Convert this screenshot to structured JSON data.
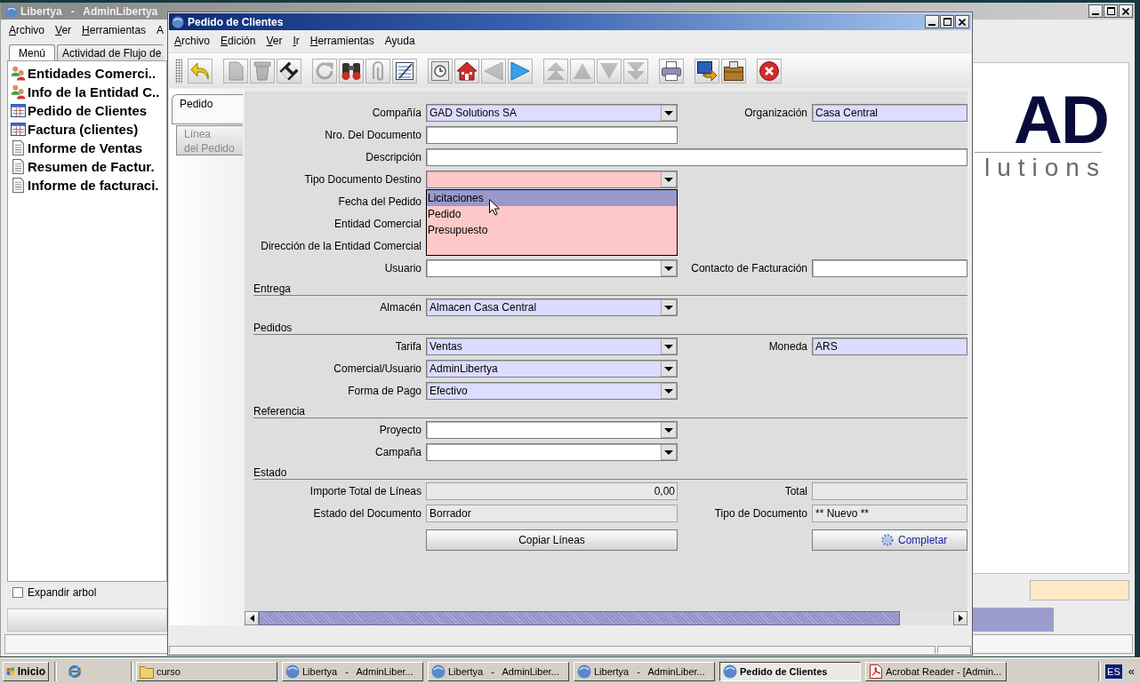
{
  "main_window": {
    "title": "Libertya   -   AdminLibertya",
    "menu": [
      {
        "label": "Archivo",
        "mnemonic": true
      },
      {
        "label": "Ver",
        "mnemonic": true
      },
      {
        "label": "Herramientas",
        "mnemonic": true
      },
      {
        "label": "A",
        "mnemonic": false
      }
    ],
    "tabs": [
      {
        "label": "Menú",
        "selected": true
      },
      {
        "label": "Actividad de Flujo de",
        "selected": false
      }
    ],
    "menu_tree": [
      {
        "label": "Entidades Comerci..",
        "kind": "entity"
      },
      {
        "label": "Info de la Entidad C..",
        "kind": "entity"
      },
      {
        "label": "Pedido de Clientes",
        "kind": "window"
      },
      {
        "label": "Factura (clientes)",
        "kind": "window"
      },
      {
        "label": "Informe de Ventas",
        "kind": "report"
      },
      {
        "label": "Resumen de Factur.",
        "kind": "report"
      },
      {
        "label": "Informe de facturaci.",
        "kind": "report"
      }
    ],
    "expand_tree": {
      "label": "Expandir arbol",
      "checked": false
    },
    "logo": {
      "mark": "AD",
      "tagline": "lutions"
    }
  },
  "order_window": {
    "title": "Pedido de Clientes",
    "menu": [
      {
        "label": "Archivo",
        "mnemonic": true
      },
      {
        "label": "Edición",
        "mnemonic": true
      },
      {
        "label": "Ver",
        "mnemonic": true
      },
      {
        "label": "Ir",
        "mnemonic": true
      },
      {
        "label": "Herramientas",
        "mnemonic": true
      },
      {
        "label": "Ayuda",
        "mnemonic": false
      }
    ],
    "toolbar": [
      {
        "buttons": [
          {
            "disabled": false
          }
        ]
      },
      {
        "buttons": [
          {
            "disabled": true
          },
          {
            "disabled": true
          },
          {
            "disabled": false
          }
        ]
      },
      {
        "buttons": [
          {
            "disabled": true
          },
          {
            "disabled": false
          },
          {
            "disabled": true
          },
          {
            "disabled": false
          }
        ]
      },
      {
        "buttons": [
          {
            "disabled": false
          },
          {
            "disabled": false
          },
          {
            "disabled": true
          },
          {
            "disabled": false
          }
        ]
      },
      {
        "buttons": [
          {
            "disabled": true
          },
          {
            "disabled": true
          },
          {
            "disabled": true
          },
          {
            "disabled": true
          }
        ]
      },
      {
        "buttons": [
          {
            "disabled": false
          }
        ]
      },
      {
        "buttons": [
          {
            "disabled": false
          },
          {
            "disabled": false
          }
        ]
      },
      {
        "buttons": [
          {
            "disabled": false
          }
        ]
      }
    ],
    "tabs": [
      {
        "label": "Pedido",
        "selected": true
      },
      {
        "label": "Línea\ndel Pedido",
        "selected": false
      }
    ],
    "form": [
      {
        "kind": "row",
        "fields": [
          {
            "label": "Compañía",
            "kind": "combo",
            "mandatory": true,
            "read_only": false,
            "value": "GAD Solutions SA"
          },
          {
            "label": "Organización",
            "kind": "text",
            "mandatory": true,
            "read_only": false,
            "value": "Casa Central"
          }
        ]
      },
      {
        "kind": "row",
        "fields": [
          {
            "label": "Nro. Del Documento",
            "kind": "text",
            "mandatory": false,
            "read_only": false
          }
        ]
      },
      {
        "kind": "row",
        "fields": [
          {
            "label": "Descripción",
            "kind": "long_text",
            "mandatory": false,
            "read_only": false
          }
        ]
      },
      {
        "kind": "row",
        "fields": [
          {
            "label": "Tipo Documento Destino",
            "kind": "combo",
            "mandatory": true,
            "read_only": false,
            "open": true,
            "options": [
              {
                "label": "Licitaciones",
                "selected": true
              },
              {
                "label": "Pedido",
                "selected": false
              },
              {
                "label": "Presupuesto",
                "selected": false
              }
            ]
          }
        ]
      },
      {
        "kind": "row",
        "fields": [
          {
            "label": "Fecha del Pedido"
          }
        ]
      },
      {
        "kind": "row",
        "fields": [
          {
            "label": "Entidad Comercial"
          }
        ]
      },
      {
        "kind": "row",
        "fields": [
          {
            "label": "Dirección de la Entidad Comercial"
          }
        ]
      },
      {
        "kind": "row",
        "fields": [
          {
            "label": "Usuario",
            "kind": "combo",
            "mandatory": false,
            "read_only": false
          },
          {
            "label": "Contacto de Facturación",
            "kind": "text",
            "mandatory": false,
            "read_only": false
          }
        ]
      },
      {
        "kind": "section",
        "label": "Entrega"
      },
      {
        "kind": "row",
        "fields": [
          {
            "label": "Almacén",
            "kind": "combo",
            "mandatory": true,
            "read_only": false,
            "value": "Almacen Casa Central"
          }
        ]
      },
      {
        "kind": "section",
        "label": "Pedidos"
      },
      {
        "kind": "row",
        "fields": [
          {
            "label": "Tarifa",
            "kind": "combo",
            "mandatory": true,
            "read_only": false,
            "value": "Ventas"
          },
          {
            "label": "Moneda",
            "kind": "text",
            "mandatory": true,
            "read_only": false,
            "value": "ARS"
          }
        ]
      },
      {
        "kind": "row",
        "fields": [
          {
            "label": "Comercial/Usuario",
            "kind": "combo",
            "mandatory": true,
            "read_only": false,
            "value": "AdminLibertya"
          }
        ]
      },
      {
        "kind": "row",
        "fields": [
          {
            "label": "Forma de Pago",
            "kind": "combo",
            "mandatory": true,
            "read_only": false,
            "value": "Efectivo"
          }
        ]
      },
      {
        "kind": "section",
        "label": "Referencia"
      },
      {
        "kind": "row",
        "fields": [
          {
            "label": "Proyecto",
            "kind": "combo",
            "mandatory": false,
            "read_only": false
          }
        ]
      },
      {
        "kind": "row",
        "fields": [
          {
            "label": "Campaña",
            "kind": "combo",
            "mandatory": false,
            "read_only": false
          }
        ]
      },
      {
        "kind": "section",
        "label": "Estado"
      },
      {
        "kind": "row",
        "fields": [
          {
            "label": "Importe Total de Líneas",
            "kind": "number",
            "read_only": true,
            "value": "0,00"
          },
          {
            "label": "Total",
            "kind": "number",
            "read_only": true
          }
        ]
      },
      {
        "kind": "row",
        "fields": [
          {
            "label": "Estado del Documento",
            "kind": "text",
            "read_only": true,
            "value": "Borrador"
          },
          {
            "label": "Tipo de Documento",
            "kind": "text",
            "read_only": true,
            "value": "** Nuevo **"
          }
        ]
      },
      {
        "kind": "buttons",
        "buttons": [
          {
            "label": "Copiar Líneas",
            "kind": "plain"
          },
          {
            "label": "Completar",
            "kind": "process"
          }
        ]
      }
    ]
  },
  "taskbar": {
    "start": "Inicio",
    "tasks": [
      {
        "label": "curso",
        "kind": "folder",
        "selected": false
      },
      {
        "label": "Libertya   -   AdminLiber...",
        "kind": "app",
        "selected": false
      },
      {
        "label": "Libertya   -   AdminLiber...",
        "kind": "app",
        "selected": false
      },
      {
        "label": "Libertya   -   AdminLiber...",
        "kind": "app",
        "selected": false
      },
      {
        "label": "Pedido de Clientes",
        "kind": "app",
        "selected": true
      },
      {
        "label": "Acrobat Reader - [Admin...",
        "kind": "pdf",
        "selected": false
      }
    ],
    "language": "ES",
    "tray_toggle": "«"
  }
}
